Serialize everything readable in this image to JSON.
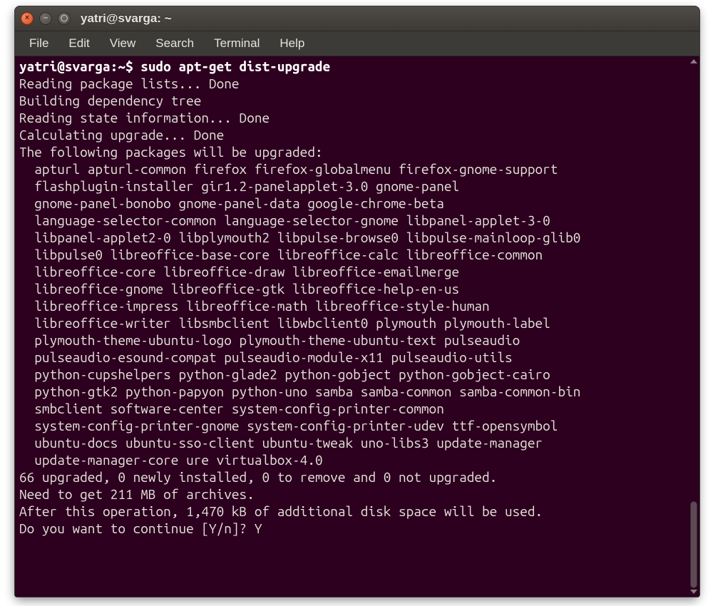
{
  "titlebar": {
    "title": "yatri@svarga: ~",
    "close_icon": "×",
    "min_icon": "–",
    "max_icon": "◯"
  },
  "menubar": {
    "items": [
      "File",
      "Edit",
      "View",
      "Search",
      "Terminal",
      "Help"
    ]
  },
  "terminal": {
    "prompt": "yatri@svarga:~$",
    "command": "sudo apt-get dist-upgrade",
    "lines": [
      "Reading package lists... Done",
      "Building dependency tree       ",
      "Reading state information... Done",
      "Calculating upgrade... Done",
      "The following packages will be upgraded:",
      "  apturl apturl-common firefox firefox-globalmenu firefox-gnome-support",
      "  flashplugin-installer gir1.2-panelapplet-3.0 gnome-panel",
      "  gnome-panel-bonobo gnome-panel-data google-chrome-beta",
      "  language-selector-common language-selector-gnome libpanel-applet-3-0",
      "  libpanel-applet2-0 libplymouth2 libpulse-browse0 libpulse-mainloop-glib0",
      "  libpulse0 libreoffice-base-core libreoffice-calc libreoffice-common",
      "  libreoffice-core libreoffice-draw libreoffice-emailmerge",
      "  libreoffice-gnome libreoffice-gtk libreoffice-help-en-us",
      "  libreoffice-impress libreoffice-math libreoffice-style-human",
      "  libreoffice-writer libsmbclient libwbclient0 plymouth plymouth-label",
      "  plymouth-theme-ubuntu-logo plymouth-theme-ubuntu-text pulseaudio",
      "  pulseaudio-esound-compat pulseaudio-module-x11 pulseaudio-utils",
      "  python-cupshelpers python-glade2 python-gobject python-gobject-cairo",
      "  python-gtk2 python-papyon python-uno samba samba-common samba-common-bin",
      "  smbclient software-center system-config-printer-common",
      "  system-config-printer-gnome system-config-printer-udev ttf-opensymbol",
      "  ubuntu-docs ubuntu-sso-client ubuntu-tweak uno-libs3 update-manager",
      "  update-manager-core ure virtualbox-4.0",
      "66 upgraded, 0 newly installed, 0 to remove and 0 not upgraded.",
      "Need to get 211 MB of archives.",
      "After this operation, 1,470 kB of additional disk space will be used.",
      "Do you want to continue [Y/n]? Y"
    ]
  },
  "colors": {
    "terminal_bg": "#2c001e",
    "terminal_fg": "#e6e1dc",
    "titlebar_bg": "#3d3935",
    "close_btn": "#d9461c"
  }
}
